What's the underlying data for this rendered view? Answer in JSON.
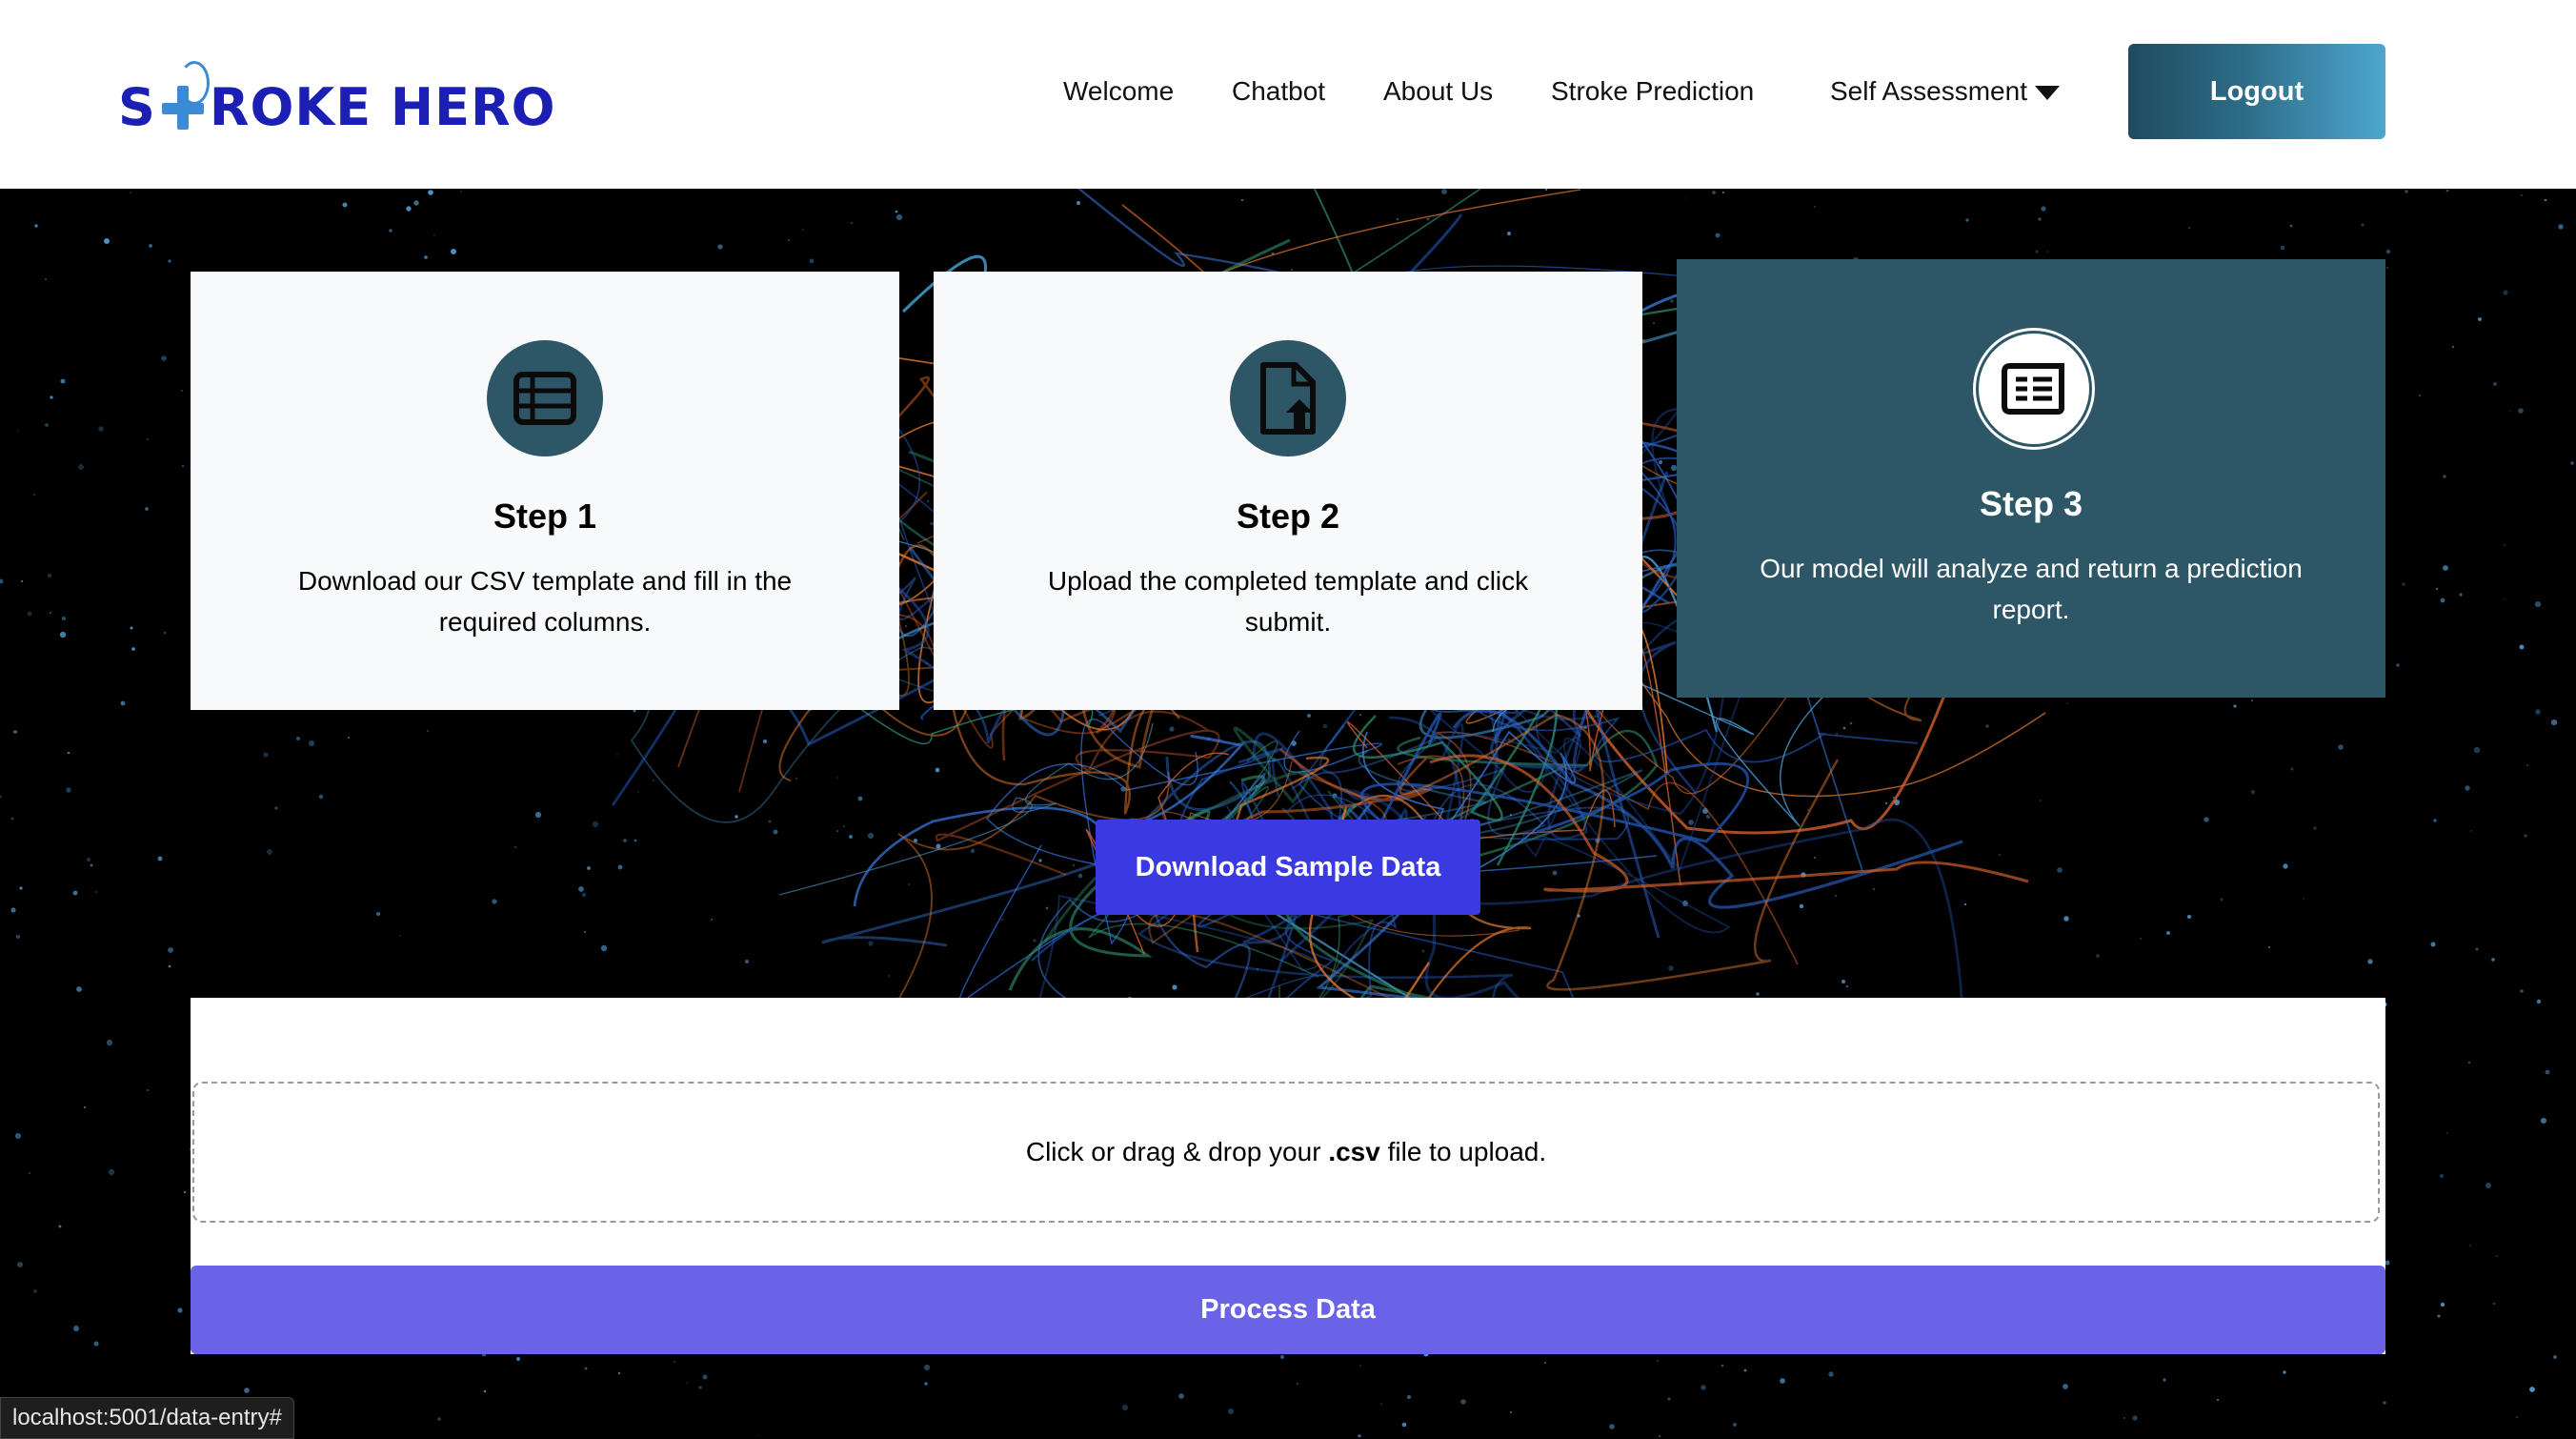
{
  "app": {
    "logo_text_left": "S",
    "logo_text_right": "ROKE HERO",
    "brand_color": "#1b1fb3",
    "accent_color": "#3a8ad6"
  },
  "nav": {
    "items": [
      {
        "label": "Welcome"
      },
      {
        "label": "Chatbot"
      },
      {
        "label": "About Us"
      },
      {
        "label": "Stroke Prediction"
      },
      {
        "label": "Self Assessment"
      }
    ],
    "dropdown_icon": "caret-down-icon",
    "logout_label": "Logout"
  },
  "steps": [
    {
      "title": "Step 1",
      "description": "Download our CSV template and fill in the required columns.",
      "icon": "table-icon",
      "active": false
    },
    {
      "title": "Step 2",
      "description": "Upload the completed template and click submit.",
      "icon": "file-upload-icon",
      "active": false
    },
    {
      "title": "Step 3",
      "description": "Our model will analyze and return a prediction report.",
      "icon": "report-icon",
      "active": true
    }
  ],
  "download": {
    "label": "Download Sample Data"
  },
  "upload": {
    "prefix": "Click or drag & drop your ",
    "ext": ".csv",
    "suffix": " file to upload."
  },
  "process": {
    "label": "Process Data"
  },
  "status_bar": {
    "url": "localhost:5001/data-entry#"
  },
  "colors": {
    "step_icon_bg": "#2d5767",
    "download_button": "#3a3ae3",
    "process_button": "#6a63e8"
  }
}
